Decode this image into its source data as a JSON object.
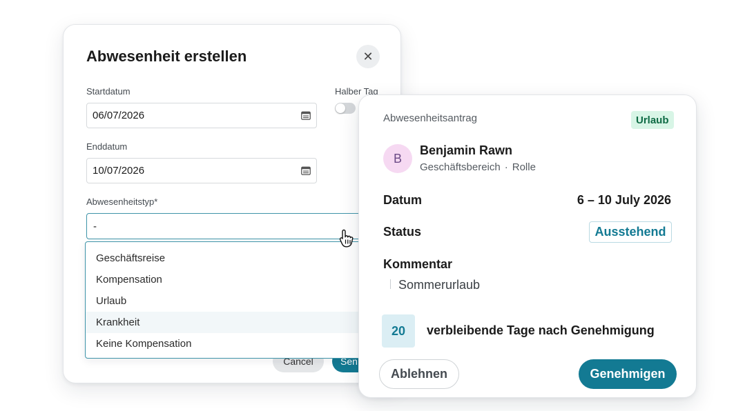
{
  "dialog": {
    "title": "Abwesenheit erstellen",
    "close_icon": "close-icon",
    "start_label": "Startdatum",
    "start_value": "06/07/2026",
    "half_day_label": "Halber Tag",
    "end_label": "Enddatum",
    "end_value": "10/07/2026",
    "type_label": "Abwesenheitstyp*",
    "type_value": "-",
    "options": [
      "Geschäftsreise",
      "Kompensation",
      "Urlaub",
      "Krankheit",
      "Keine Kompensation"
    ],
    "cancel_label": "Cancel",
    "send_label": "Sen"
  },
  "card": {
    "header": "Abwesenheitsantrag",
    "type_badge": "Urlaub",
    "avatar_initial": "B",
    "name": "Benjamin Rawn",
    "department": "Geschäftsbereich",
    "separator": "·",
    "role": "Rolle",
    "date_label": "Datum",
    "date_value": "6 – 10 July 2026",
    "status_label": "Status",
    "status_value": "Ausstehend",
    "comment_label": "Kommentar",
    "comment_value": "Sommerurlaub",
    "days_remaining": "20",
    "days_text": "verbleibende Tage nach Genehmigung",
    "reject_label": "Ablehnen",
    "approve_label": "Genehmigen"
  },
  "colors": {
    "primary": "#137a93",
    "badge_green_bg": "#d8f5e6",
    "avatar_bg": "#f6d9f2"
  }
}
